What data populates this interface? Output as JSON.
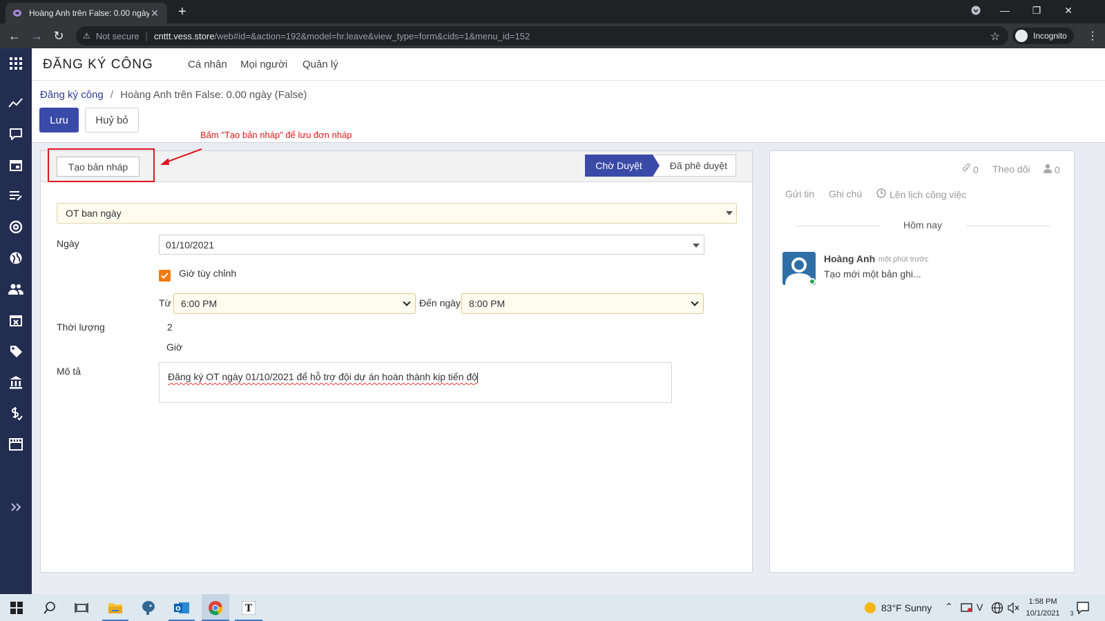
{
  "browser": {
    "tab_title": "Hoàng Anh trên False: 0.00 ngày",
    "security_label": "Not secure",
    "url_host": "cnttt.vess.store",
    "url_path": "/web#id=&action=192&model=hr.leave&view_type=form&cids=1&menu_id=152",
    "incognito_label": "Incognito"
  },
  "navbar": {
    "app_title": "ĐĂNG KÝ CÔNG",
    "menu": [
      "Cá nhân",
      "Mọi người",
      "Quản lý"
    ]
  },
  "breadcrumb": {
    "parent": "Đăng ký công",
    "current": "Hoàng Anh trên False: 0.00 ngày (False)"
  },
  "actions": {
    "save_label": "Lưu",
    "discard_label": "Huỷ bỏ"
  },
  "annotation": {
    "note": "Bấm \"Tạo bản nháp\" để lưu đơn nháp"
  },
  "statusbar": {
    "draft_button": "Tạo bản nháp",
    "stages": [
      "Chờ Duyệt",
      "Đã phê duyệt"
    ],
    "active_stage": "Chờ Duyệt"
  },
  "form": {
    "leave_type": "OT ban ngày",
    "date_label": "Ngày",
    "date_value": "01/10/2021",
    "custom_hours_label": "Giờ tùy chỉnh",
    "custom_hours_checked": true,
    "from_label": "Từ",
    "from_value": "6:00 PM",
    "to_label": "Đến ngày",
    "to_value": "8:00 PM",
    "duration_label": "Thời lượng",
    "duration_value": "2",
    "duration_unit": "Giờ",
    "description_label": "Mô tả",
    "description_value": "Đăng ký OT ngày 01/10/2021 để hỗ trợ đội dự án hoàn thành kịp tiến độ"
  },
  "chatter": {
    "attachments_count": "0",
    "follow_label": "Theo dõi",
    "followers_count": "0",
    "send_message": "Gửi tin",
    "log_note": "Ghi chú",
    "schedule_activity": "Lên lịch công việc",
    "day_separator": "Hôm nay",
    "message": {
      "author": "Hoàng Anh",
      "date": "- một phút trước",
      "body": "Tạo mới một bản ghi..."
    }
  },
  "taskbar": {
    "weather": "83°F  Sunny",
    "time": "1:58 PM",
    "date": "10/1/2021",
    "notifications": "3"
  },
  "colors": {
    "primary": "#3a4aa8",
    "sidebar": "#232d52",
    "annotation": "#e3141c",
    "checkbox": "#f07b14"
  }
}
